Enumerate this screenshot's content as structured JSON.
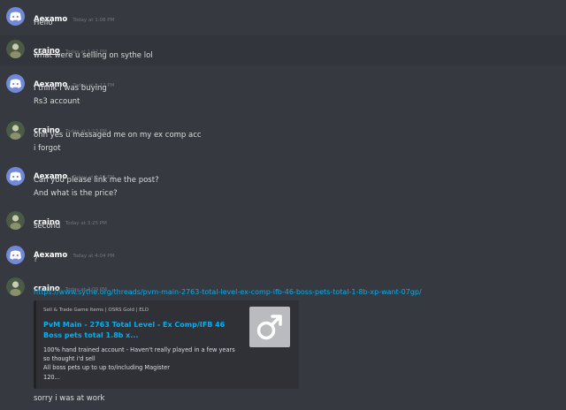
{
  "messages": [
    {
      "author": "Aexamo",
      "author_underlined": false,
      "avatar": "discord-default-avatar",
      "timestamp": "Today at 1:08 PM",
      "lines": [
        "Hello"
      ]
    },
    {
      "author": "craino",
      "author_underlined": true,
      "avatar": "user-avatar",
      "timestamp": "Today at 1:12 PM",
      "lines": [
        "what were u selling on sythe lol"
      ]
    },
    {
      "author": "Aexamo",
      "author_underlined": false,
      "avatar": "discord-default-avatar",
      "timestamp": "Today at 1:12 PM",
      "lines": [
        "I think I was buying",
        "Rs3 account"
      ]
    },
    {
      "author": "craino",
      "author_underlined": false,
      "avatar": "user-avatar",
      "timestamp": "Today at 1:13 PM",
      "lines": [
        "ohh yes u messaged me on my ex comp acc",
        "i forgot"
      ]
    },
    {
      "author": "Aexamo",
      "author_underlined": false,
      "avatar": "discord-default-avatar",
      "timestamp": "Today at 1:50 PM",
      "lines": [
        "Can you please link me the post?",
        "And what is the price?"
      ]
    },
    {
      "author": "craino",
      "author_underlined": false,
      "avatar": "user-avatar",
      "timestamp": "Today at 3:25 PM",
      "lines": [
        "second"
      ]
    },
    {
      "author": "Aexamo",
      "author_underlined": false,
      "avatar": "discord-default-avatar",
      "timestamp": "Today at 4:04 PM",
      "lines": [
        "?"
      ]
    },
    {
      "author": "craino",
      "author_underlined": false,
      "avatar": "user-avatar",
      "timestamp": "Today at 4:09 PM",
      "link": "https://www.sythe.org/threads/pvm-main-2763-total-level-ex-comp-ifb-46-boss-pets-total-1-8b-xp-want-07gp/",
      "embed": {
        "provider": "Sell & Trade Game Items | OSRS Gold | ELO",
        "title": "PvM Main - 2763 Total Level - Ex Comp/IFB 46 Boss pets total 1.8b x...",
        "description": [
          "100% hand trained account - Haven't really played in a few years",
          "so thought i'd sell",
          "All boss pets up to up to/including Magister",
          "120..."
        ],
        "thumbnail_icon": "male-symbol-icon"
      },
      "after": "sorry i was at work"
    }
  ],
  "colors": {
    "background": "#36393f",
    "username": "#ffffff",
    "timestamp": "#72767d",
    "text": "#dcddde",
    "link": "#00b0f4",
    "embed_bg": "#2f3136",
    "discord_blurple": "#7289da"
  }
}
